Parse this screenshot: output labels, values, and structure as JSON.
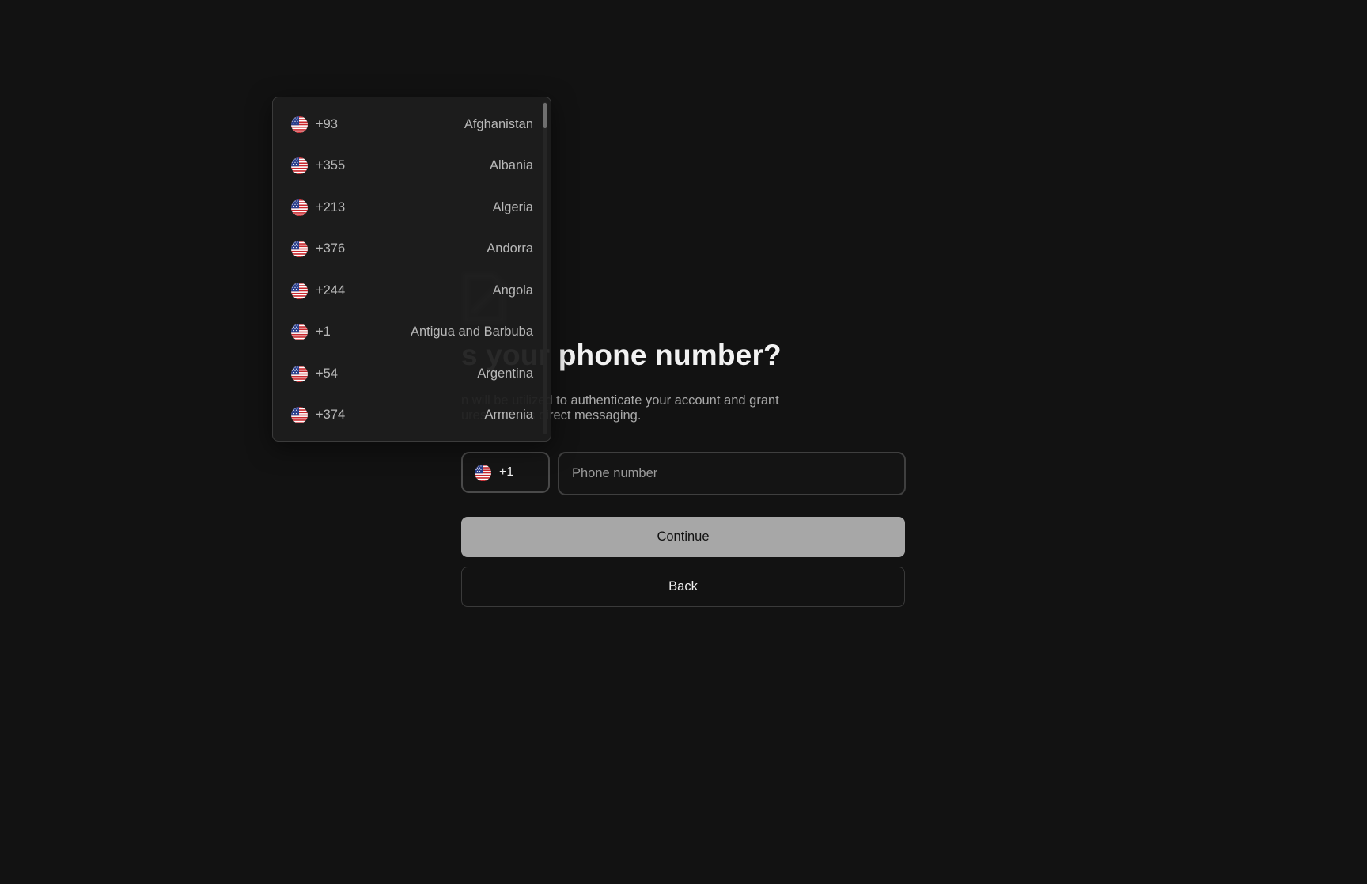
{
  "page": {
    "title_visible": "s your phone number?",
    "subtitle_line1": "n will be utilized to authenticate your account and grant",
    "subtitle_line2": "ures such as direct messaging."
  },
  "phone": {
    "country_code": "+1",
    "country_flag_icon": "us-flag-icon",
    "placeholder": "Phone number",
    "value": ""
  },
  "buttons": {
    "continue": "Continue",
    "back": "Back"
  },
  "dropdown": {
    "items": [
      {
        "dial": "+93",
        "country": "Afghanistan",
        "flag": "us-flag-icon"
      },
      {
        "dial": "+355",
        "country": "Albania",
        "flag": "us-flag-icon"
      },
      {
        "dial": "+213",
        "country": "Algeria",
        "flag": "us-flag-icon"
      },
      {
        "dial": "+376",
        "country": "Andorra",
        "flag": "us-flag-icon"
      },
      {
        "dial": "+244",
        "country": "Angola",
        "flag": "us-flag-icon"
      },
      {
        "dial": "+1",
        "country": "Antigua and Barbuba",
        "flag": "us-flag-icon"
      },
      {
        "dial": "+54",
        "country": "Argentina",
        "flag": "us-flag-icon"
      },
      {
        "dial": "+374",
        "country": "Armenia",
        "flag": "us-flag-icon"
      }
    ]
  },
  "colors": {
    "background": "#121212",
    "continue_bg": "#a7a7a7",
    "text_primary": "#f2f2f2",
    "text_muted": "#a9a9a9"
  }
}
